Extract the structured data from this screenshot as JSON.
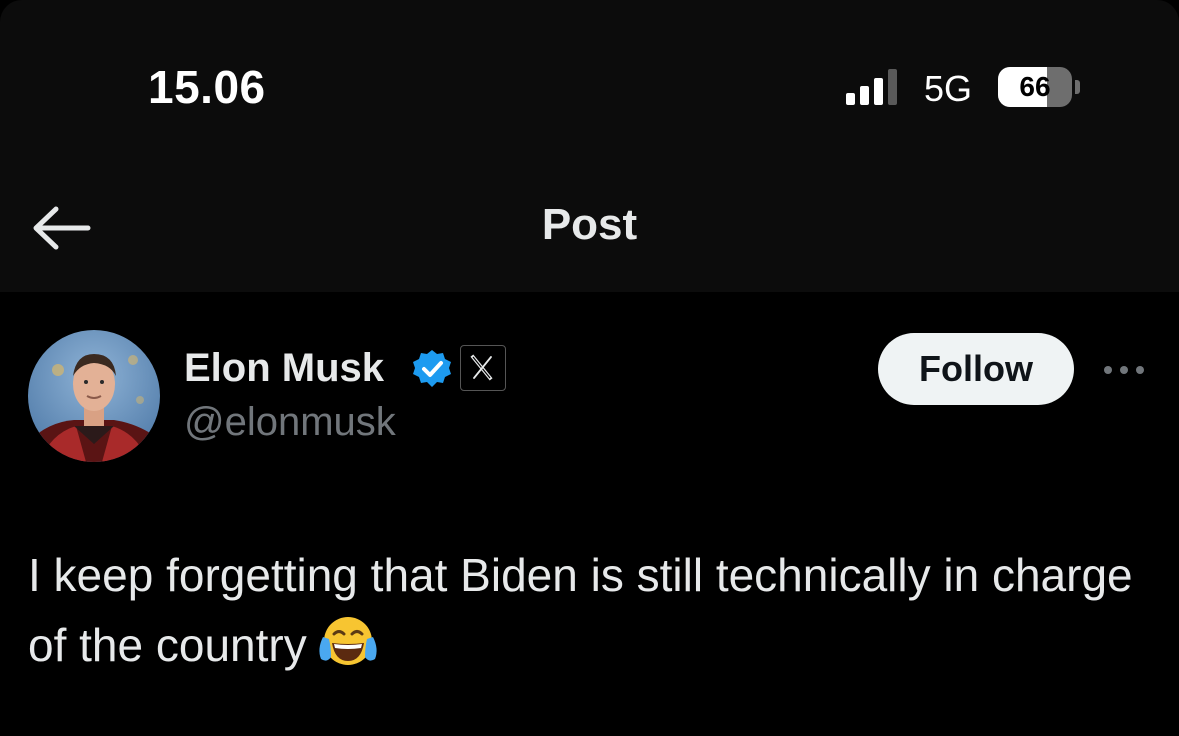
{
  "status_bar": {
    "time": "15.06",
    "network": "5G",
    "battery_level": "66",
    "battery_fraction": 0.66,
    "signal_bars_active": 3,
    "signal_bars_total": 4
  },
  "header": {
    "title": "Post",
    "back_icon": "arrow-left-icon"
  },
  "post": {
    "author": {
      "name": "Elon Musk",
      "handle": "@elonmusk",
      "verified": true,
      "verified_color": "#1d9bf0",
      "affiliate_badge": "x-logo-icon"
    },
    "follow_label": "Follow",
    "more_icon": "more-horizontal-icon",
    "text": "I keep forgetting that Biden is still technically in charge of the country",
    "emoji": "face-with-tears-of-joy-icon"
  },
  "colors": {
    "background": "#000000",
    "header_background": "#0c0c0c",
    "text_primary": "#e7e9ea",
    "text_secondary": "#71767b",
    "follow_button_bg": "#eff3f4"
  }
}
